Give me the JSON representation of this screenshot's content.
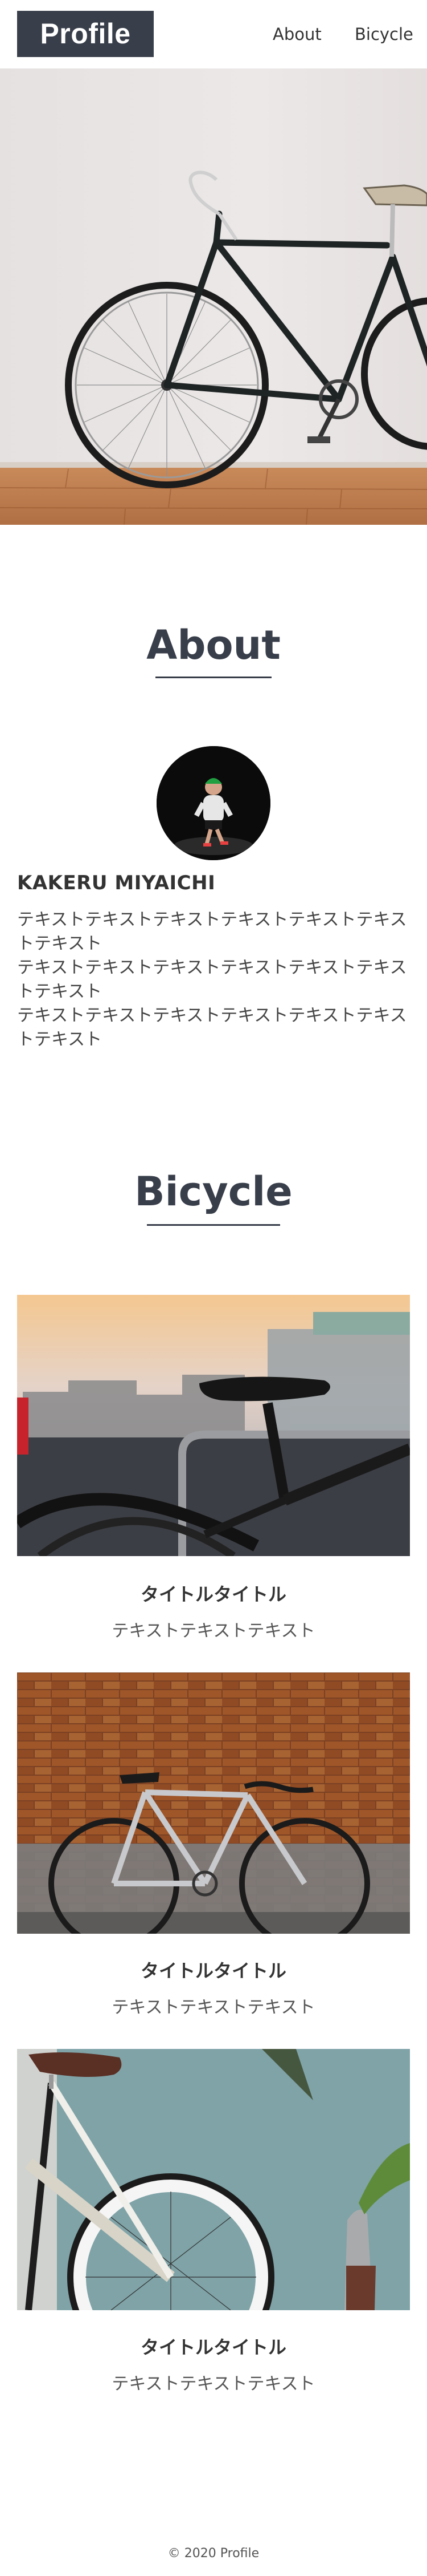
{
  "header": {
    "logo": "Profile",
    "nav": [
      {
        "label": "About"
      },
      {
        "label": "Bicycle"
      }
    ]
  },
  "about": {
    "title": "About",
    "name": "KAKERU MIYAICHI",
    "paragraphs": [
      "テキストテキストテキストテキストテキストテキストテキスト",
      "テキストテキストテキストテキストテキストテキストテキスト",
      "テキストテキストテキストテキストテキストテキストテキスト"
    ]
  },
  "bicycle": {
    "title": "Bicycle",
    "cards": [
      {
        "title": "タイトルタイトル",
        "text": "テキストテキストテキスト"
      },
      {
        "title": "タイトルタイトル",
        "text": "テキストテキストテキスト"
      },
      {
        "title": "タイトルタイトル",
        "text": "テキストテキストテキスト"
      }
    ]
  },
  "footer": {
    "copyright": "© 2020 Profile"
  },
  "colors": {
    "primary": "#383e4a",
    "text": "#333333",
    "background": "#ffffff"
  }
}
